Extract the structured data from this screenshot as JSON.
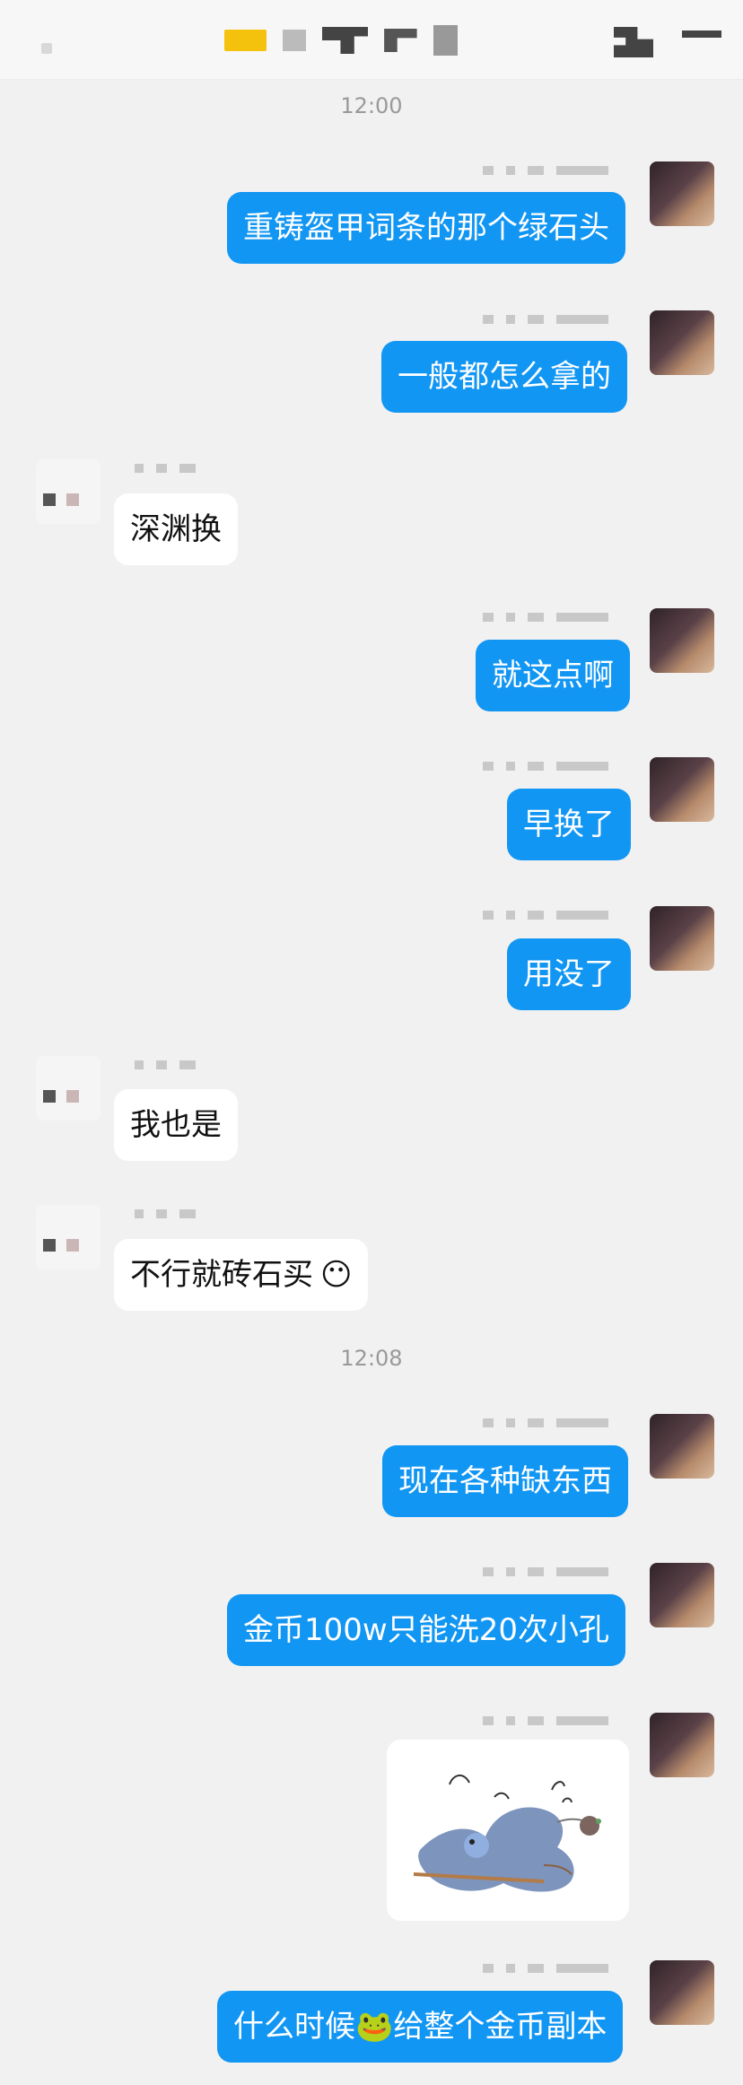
{
  "header": {
    "icons": [
      "back-icon",
      "call-icon",
      "menu-icon"
    ]
  },
  "messages": [
    {
      "time": "12:00"
    },
    {
      "side": "me",
      "text": "重铸盔甲词条的那个绿石头"
    },
    {
      "side": "me",
      "text": "一般都怎么拿的"
    },
    {
      "side": "them",
      "text": "深渊换"
    },
    {
      "side": "me",
      "text": "就这点啊"
    },
    {
      "side": "me",
      "text": "早换了"
    },
    {
      "side": "me",
      "text": "用没了"
    },
    {
      "side": "them",
      "text": "我也是"
    },
    {
      "side": "them",
      "text": "不行就砖石买",
      "emoji": "😶"
    },
    {
      "time": "12:08"
    },
    {
      "side": "me",
      "text": "现在各种缺东西"
    },
    {
      "side": "me",
      "text": "金币100w只能洗20次小孔"
    },
    {
      "side": "me",
      "type": "image",
      "caption": "sticker-image"
    },
    {
      "side": "me",
      "text": "什么时候🐸给整个金币副本"
    }
  ],
  "colors": {
    "background": "#f1f1f1",
    "my_bubble": "#1296f3",
    "their_bubble": "#ffffff",
    "time_text": "#999999"
  }
}
